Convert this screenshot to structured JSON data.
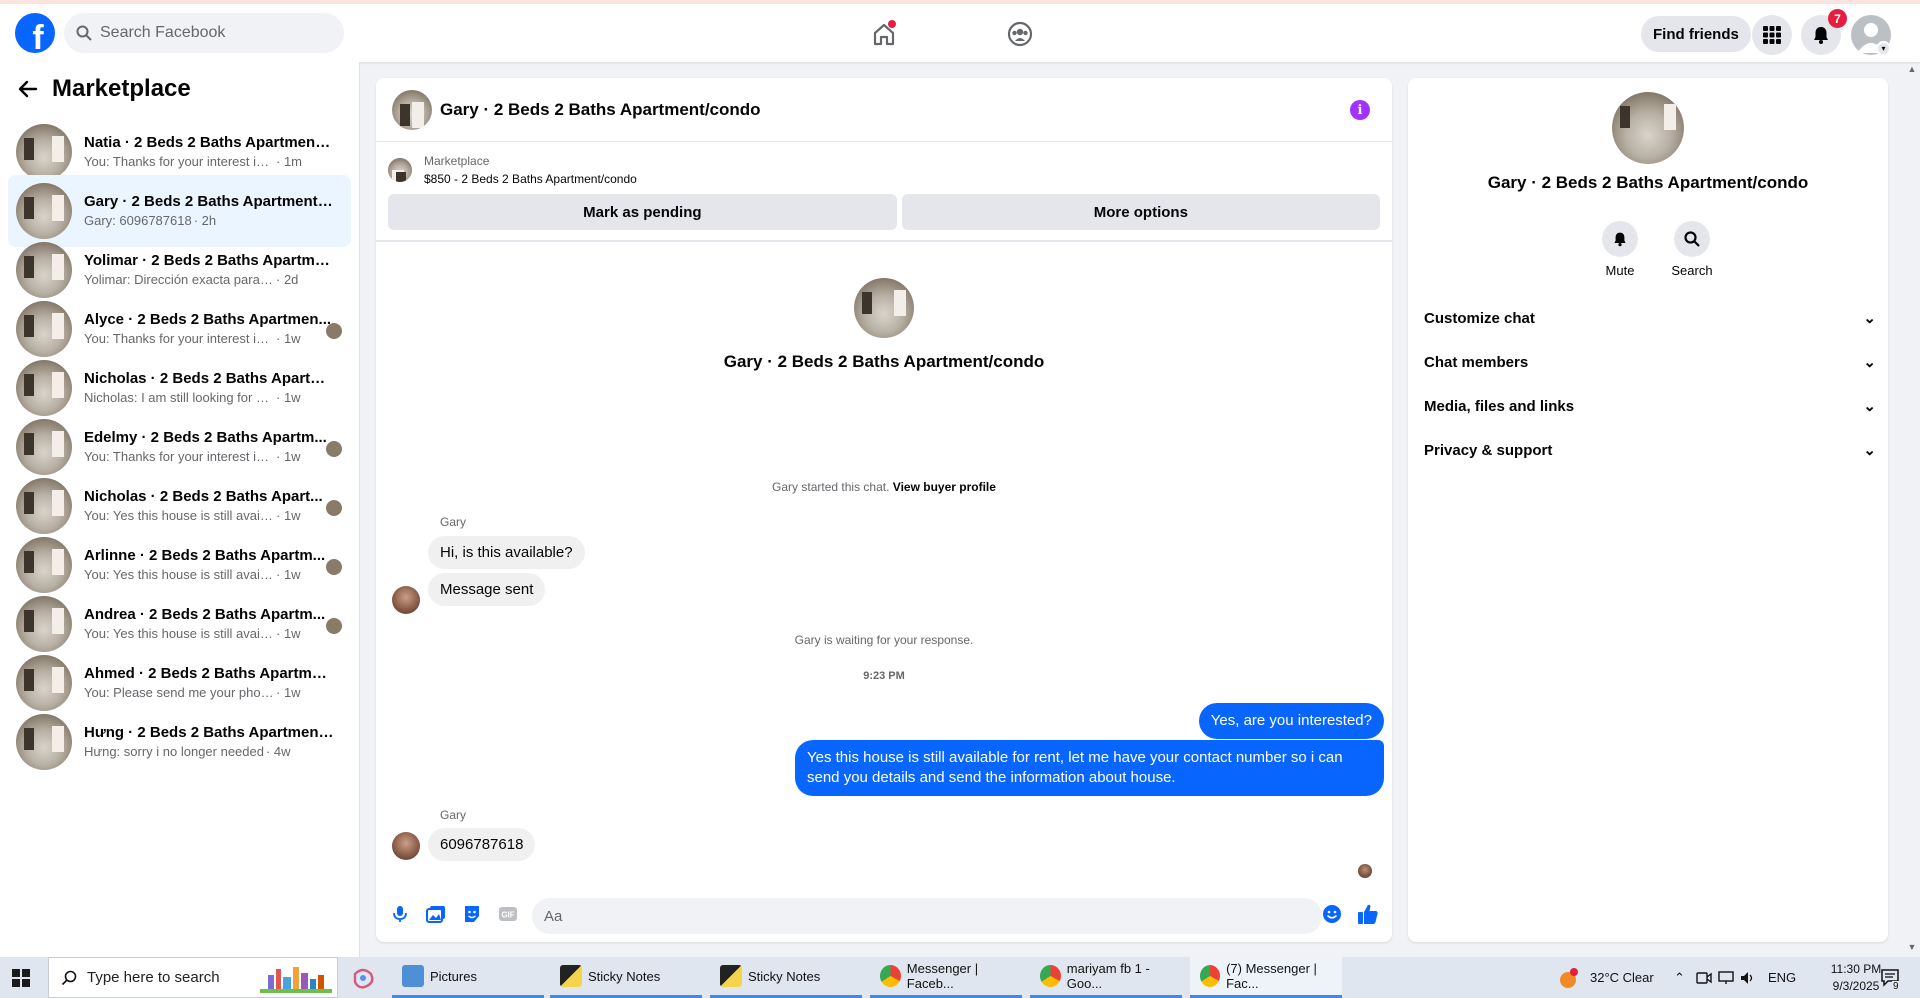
{
  "header": {
    "search_placeholder": "Search Facebook",
    "find_friends": "Find friends",
    "notification_count": "7"
  },
  "sidebar": {
    "title": "Marketplace",
    "conversations": [
      {
        "name": "Natia · 2 Beds 2 Baths Apartment/...",
        "snippet": "You: Thanks for your interest in the h...",
        "time": "· 1m",
        "avatar": false,
        "active": false
      },
      {
        "name": "Gary · 2 Beds 2 Baths Apartment/c...",
        "snippet": "Gary: 6096787618",
        "time": "· 2h",
        "avatar": false,
        "active": true
      },
      {
        "name": "Yolimar · 2 Beds 2 Baths Apartmen...",
        "snippet": "Yolimar: Dirección exacta para saber a...",
        "time": "· 2d",
        "avatar": false,
        "active": false
      },
      {
        "name": "Alyce · 2 Beds 2 Baths Apartmen...",
        "snippet": "You: Thanks for your interest in the...",
        "time": "· 1w",
        "avatar": true,
        "active": false
      },
      {
        "name": "Nicholas · 2 Beds 2 Baths Apartme...",
        "snippet": "Nicholas: I am still looking for a new l...",
        "time": "· 1w",
        "avatar": false,
        "active": false
      },
      {
        "name": "Edelmy · 2 Beds 2 Baths Apartm...",
        "snippet": "You: Thanks for your interest in the...",
        "time": "· 1w",
        "avatar": true,
        "active": false
      },
      {
        "name": "Nicholas · 2 Beds 2 Baths Apart...",
        "snippet": "You: Yes this house is still available ...",
        "time": "· 1w",
        "avatar": true,
        "active": false
      },
      {
        "name": "Arlinne · 2 Beds 2 Baths Apartm...",
        "snippet": "You: Yes this house is still available ...",
        "time": "· 1w",
        "avatar": true,
        "active": false
      },
      {
        "name": "Andrea · 2 Beds 2 Baths Apartm...",
        "snippet": "You: Yes this house is still available ...",
        "time": "· 1w",
        "avatar": true,
        "active": false
      },
      {
        "name": "Ahmed · 2 Beds 2 Baths Apartmen...",
        "snippet": "You: Please send me your phone num...",
        "time": "· 1w",
        "avatar": false,
        "active": false
      },
      {
        "name": "Hưng · 2 Beds 2 Baths Apartment/...",
        "snippet": "Hưng: sorry i no longer needed",
        "time": "· 4w",
        "avatar": false,
        "active": false
      }
    ]
  },
  "chat": {
    "title": "Gary · 2 Beds 2 Baths Apartment/condo",
    "listing_source": "Marketplace",
    "listing_line": "$850 - 2 Beds 2 Baths Apartment/condo",
    "mark_pending": "Mark as pending",
    "more_options": "More options",
    "intro_name": "Gary · 2 Beds 2 Baths Apartment/condo",
    "started": "Gary started this chat.",
    "view_profile": "View buyer profile",
    "sender": "Gary",
    "msg1": "Hi, is this available?",
    "msg2": "Message sent",
    "waiting": "Gary is waiting for your response.",
    "timestamp": "9:23 PM",
    "out1": "Yes, are you interested?",
    "out2": "Yes this house is still available for rent, let me have your contact number so i can send you details and send the information about house.",
    "sender2": "Gary",
    "msg3": "6096787618",
    "composer_placeholder": "Aa"
  },
  "details": {
    "name": "Gary · 2 Beds 2 Baths Apartment/condo",
    "mute": "Mute",
    "search": "Search",
    "rows": [
      "Customize chat",
      "Chat members",
      "Media, files and links",
      "Privacy & support"
    ]
  },
  "taskbar": {
    "search_placeholder": "Type here to search",
    "apps": [
      "Pictures",
      "Sticky Notes",
      "Sticky Notes",
      "Messenger | Faceb...",
      "mariyam fb 1 - Goo...",
      "(7) Messenger | Fac..."
    ],
    "weather": "32°C  Clear",
    "lang": "ENG",
    "time": "11:30 PM",
    "date": "9/3/2025",
    "notif_count": "9"
  },
  "colors": {
    "brand": "#0866ff",
    "badge": "#e41e3f",
    "info": "#a033ff",
    "active_row": "#ebf5ff"
  }
}
